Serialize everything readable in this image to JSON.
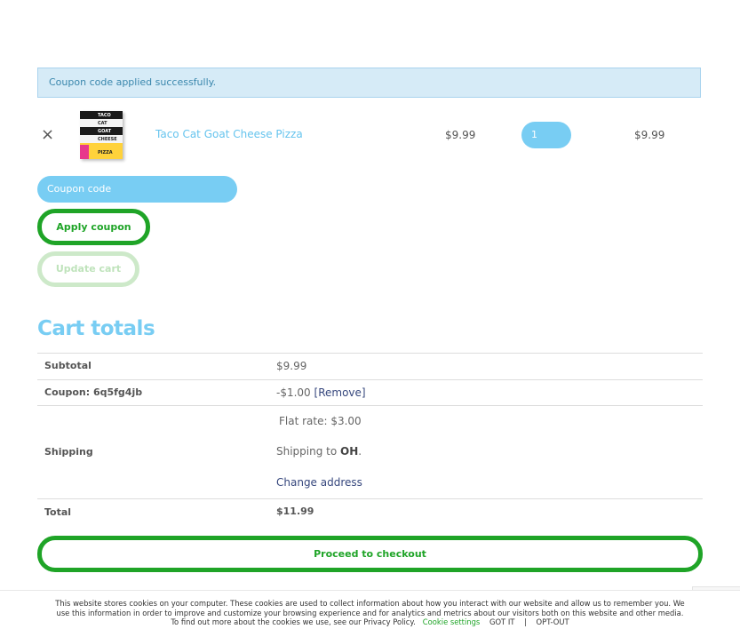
{
  "notice": {
    "message": "Coupon code applied successfully."
  },
  "cart_item": {
    "remove_symbol": "×",
    "product_name": "Taco Cat Goat Cheese Pizza",
    "thumbnail_words": [
      "TACO",
      "CAT",
      "GOAT",
      "CHEESE",
      "PIZZA"
    ],
    "price": "$9.99",
    "quantity": "1",
    "subtotal": "$9.99"
  },
  "coupon": {
    "placeholder": "Coupon code",
    "apply_label": "Apply coupon",
    "update_label": "Update cart"
  },
  "totals": {
    "title": "Cart totals",
    "subtotal_label": "Subtotal",
    "subtotal_value": "$9.99",
    "coupon_label": "Coupon: 6q5fg4jb",
    "coupon_value": "-$1.00",
    "coupon_remove": "[Remove]",
    "shipping_label": "Shipping",
    "shipping_rate": "Flat rate: $3.00",
    "shipping_to_prefix": "Shipping to ",
    "shipping_to_state": "OH",
    "shipping_to_suffix": ".",
    "change_address": "Change address",
    "total_label": "Total",
    "total_value": "$11.99"
  },
  "checkout": {
    "label": "Proceed to checkout"
  },
  "cookie_bar": {
    "text": "This website stores cookies on your computer. These cookies are used to collect information about how you interact with our website and allow us to remember you. We use this information in order to improve and customize your browsing experience and for analytics and metrics about our visitors both on this website and other media. To find out more about the cookies we use, see our Privacy Policy.",
    "settings_label": "Cookie settings",
    "got_it_label": "GOT IT",
    "separator": "|",
    "opt_out_label": "OPT-OUT"
  },
  "colors": {
    "accent_blue": "#78cdf3",
    "accent_green": "#1fa427",
    "notice_bg": "#d6ebf7"
  }
}
